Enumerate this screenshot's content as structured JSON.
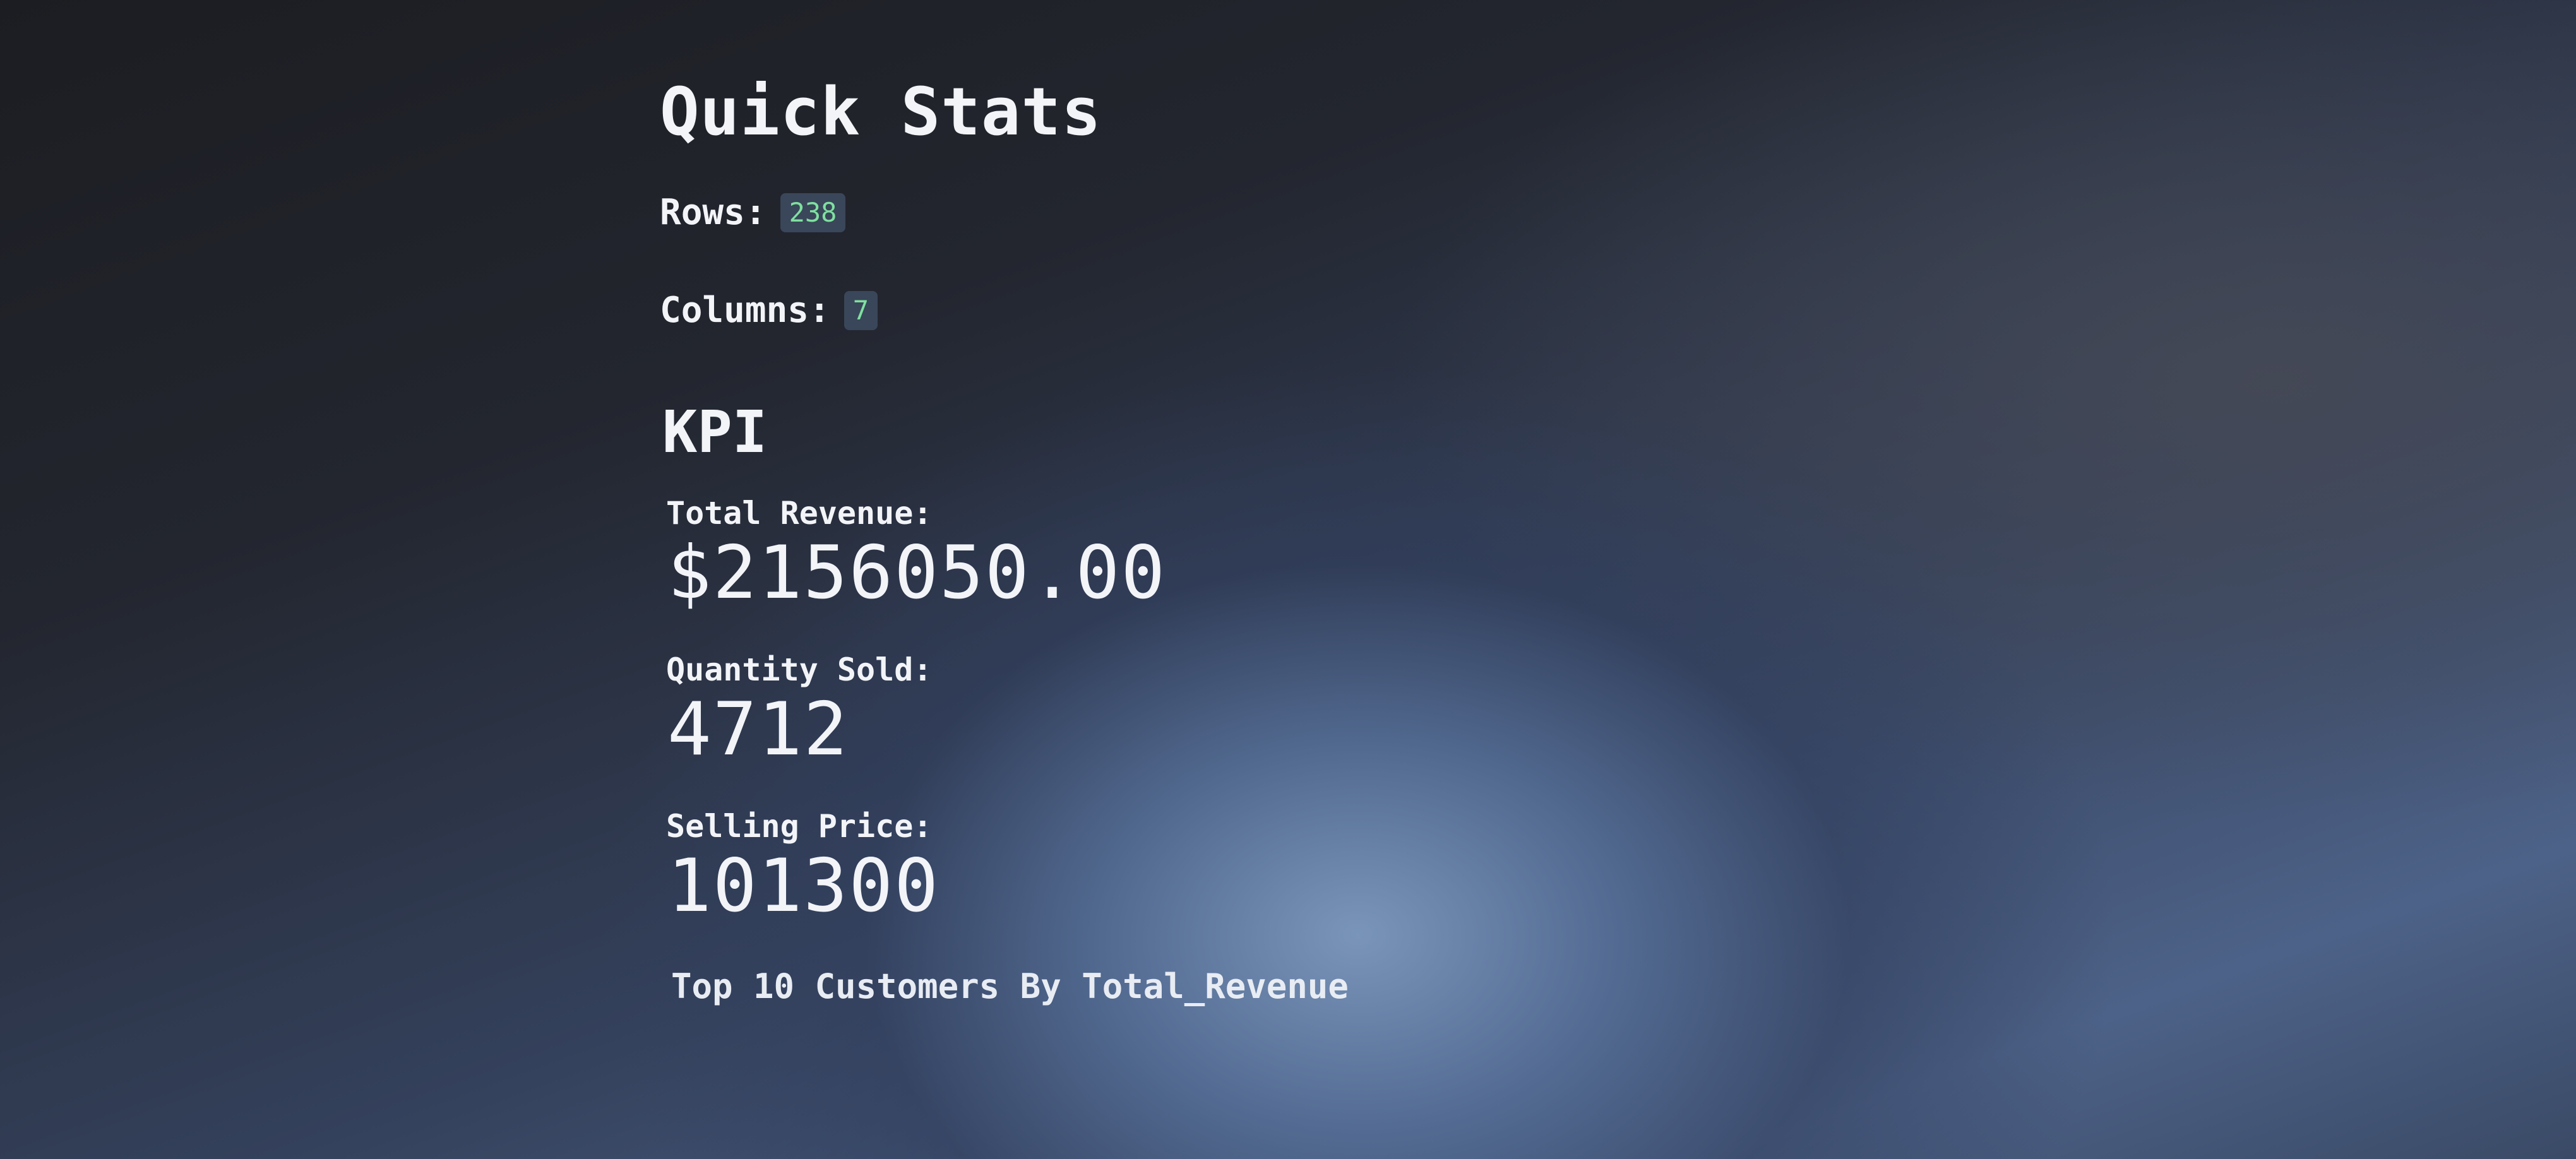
{
  "quick_stats": {
    "title": "Quick Stats",
    "rows_label": "Rows:",
    "rows_value": "238",
    "columns_label": "Columns:",
    "columns_value": "7"
  },
  "kpi": {
    "title": "KPI",
    "total_revenue_label": "Total Revenue:",
    "total_revenue_value": "$2156050.00",
    "quantity_sold_label": "Quantity Sold:",
    "quantity_sold_value": "4712",
    "selling_price_label": "Selling Price:",
    "selling_price_value": "101300"
  },
  "top_customers": {
    "title": "Top 10 Customers By Total_Revenue"
  },
  "colors": {
    "badge_bg": "#3a4659",
    "badge_text": "#7fe0a0",
    "text": "#f2f4f8"
  }
}
